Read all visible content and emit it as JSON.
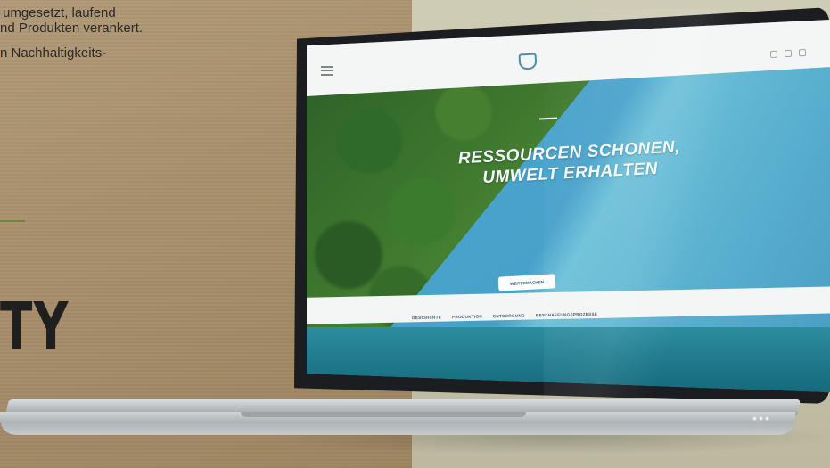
{
  "text": {
    "line1": "umgesetzt, laufend",
    "line2": "nd Produkten verankert.",
    "line3": "n Nachhaltigkeits-",
    "big_word": "TY"
  },
  "website": {
    "headline_line1": "RESSOURCEN SCHONEN,",
    "headline_line2": "UMWELT ERHALTEN",
    "cta_label": "WEITERMACHEN",
    "nav": [
      "GESCHICHTE",
      "PRODUKTION",
      "ENTSORGUNG",
      "BESCHAFFUNGSPROZESSE"
    ]
  },
  "colors": {
    "accent_green": "#6c8a3c",
    "brand_blue": "#4a8fb0"
  }
}
